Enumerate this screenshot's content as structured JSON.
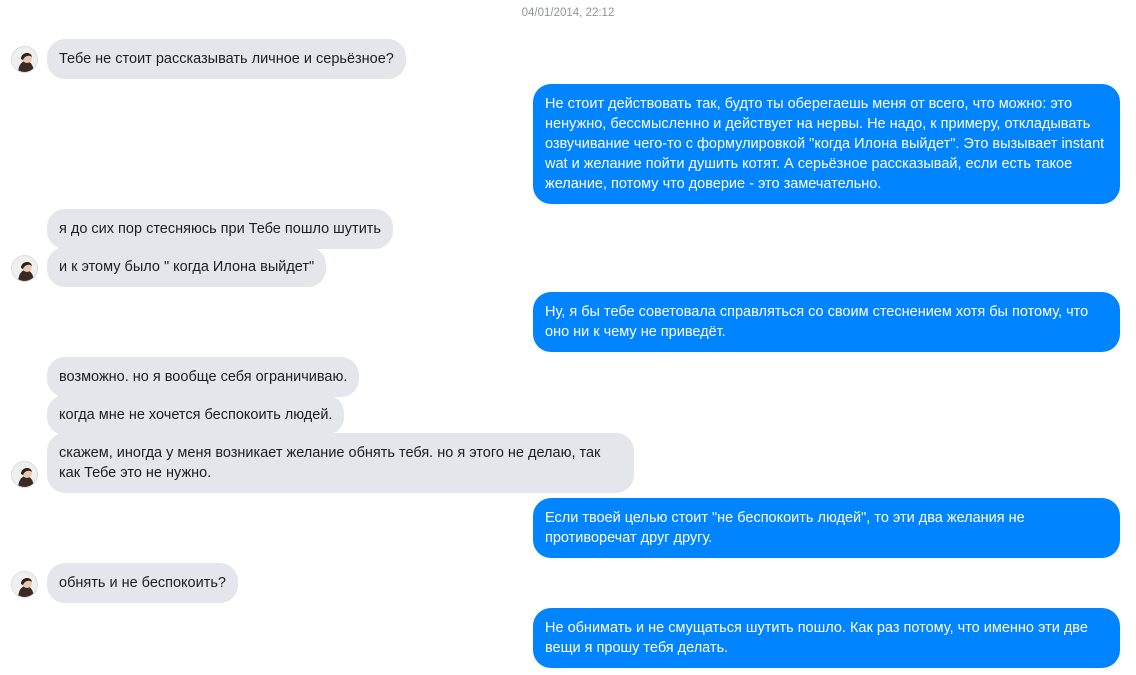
{
  "conversation": {
    "timestamp": "04/01/2014, 22:12",
    "messages": [
      {
        "direction": "incoming",
        "text": "Тебе не стоит рассказывать личное и серьёзное?"
      },
      {
        "direction": "outgoing",
        "text": "Не стоит действовать так, будто ты оберегаешь меня от всего, что можно: это ненужно, бессмысленно и действует на нервы. Не надо, к примеру, откладывать озвучивание чего-то с формулировкой \"когда Илона выйдет\". Это вызывает instant wat и желание пойти душить котят. А серьёзное рассказывай, если есть такое желание, потому что доверие - это замечательно."
      },
      {
        "direction": "incoming",
        "text": "я до сих пор стесняюсь при Тебе пошло шутить"
      },
      {
        "direction": "incoming",
        "text": "и к этому было \" когда Илона выйдет\""
      },
      {
        "direction": "outgoing",
        "text": "Ну, я бы тебе советовала справляться со своим стеснением хотя бы потому, что оно ни к чему не приведёт."
      },
      {
        "direction": "incoming",
        "text": "возможно. но я вообще себя ограничиваю."
      },
      {
        "direction": "incoming",
        "text": "когда мне не хочется беспокоить людей."
      },
      {
        "direction": "incoming",
        "text": "скажем, иногда у меня возникает желание обнять тебя. но я этого не делаю, так как Тебе это не нужно."
      },
      {
        "direction": "outgoing",
        "text": "Если твоей целью стоит \"не беспокоить людей\", то эти два желания не противоречат друг другу."
      },
      {
        "direction": "incoming",
        "text": "обнять и не беспокоить?"
      },
      {
        "direction": "outgoing",
        "text": "Не обнимать и не смущаться шутить пошло. Как раз потому, что именно эти две вещи я прошу тебя делать."
      }
    ]
  },
  "colors": {
    "outgoing_bubble": "#0084ff",
    "incoming_bubble": "#e4e6eb",
    "timestamp_text": "#90949c"
  },
  "icons": {
    "avatar": "contact-avatar-icon"
  }
}
